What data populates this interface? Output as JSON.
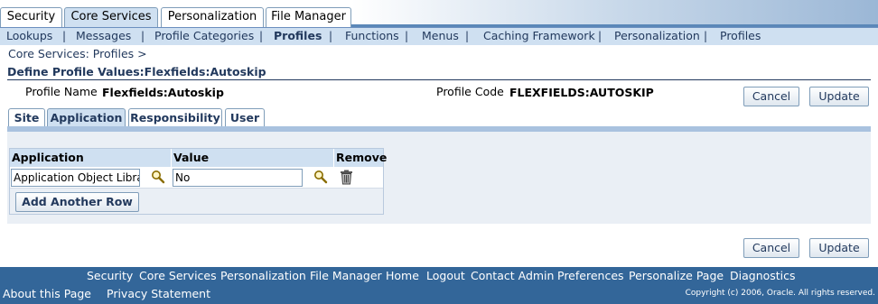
{
  "top_tabs": [
    "Security",
    "Core Services",
    "Personalization",
    "File Manager"
  ],
  "active_top_tab": "Core Services",
  "subnav": [
    "Lookups",
    "Messages",
    "Profile Categories",
    "Profiles",
    "Functions",
    "Menus",
    "Caching Framework",
    "Personalization",
    "Profiles"
  ],
  "subnav_current": "Profiles",
  "breadcrumb": "Core Services: Profiles  >",
  "page_title": "Define Profile Values:Flexfields:Autoskip",
  "profile": {
    "name_label": "Profile Name",
    "name_value": "Flexfields:Autoskip",
    "code_label": "Profile Code",
    "code_value": "FLEXFIELDS:AUTOSKIP"
  },
  "buttons": {
    "cancel": "Cancel",
    "update": "Update",
    "add_row": "Add Another Row"
  },
  "level_tabs": [
    "Site",
    "Application",
    "Responsibility",
    "User"
  ],
  "active_level_tab": "Application",
  "table": {
    "headers": [
      "Application",
      "Value",
      "Remove"
    ],
    "rows": [
      {
        "application": "Application Object Librar",
        "value": "No"
      }
    ]
  },
  "footer": {
    "links": [
      "Security",
      "Core Services",
      "Personalization",
      "File Manager",
      "Home",
      "Logout",
      "Contact Admin",
      "Preferences",
      "Personalize Page",
      "Diagnostics"
    ],
    "about": "About this Page",
    "privacy": "Privacy Statement",
    "copyright": "Copyright (c) 2006, Oracle. All rights reserved."
  },
  "colors": {
    "brand_blue": "#336699",
    "tab_active": "#cfe0f1",
    "text_navy": "#22395d"
  },
  "icons": [
    "search-icon",
    "trash-icon"
  ]
}
